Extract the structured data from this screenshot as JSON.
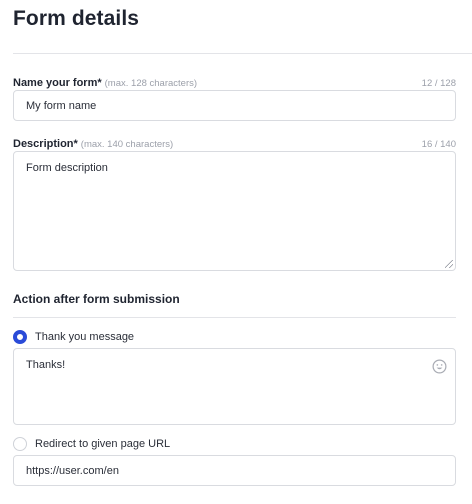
{
  "page": {
    "title": "Form details"
  },
  "form_name": {
    "label": "Name your form*",
    "hint": "(max. 128 characters)",
    "counter": "12 / 128",
    "value": "My form name"
  },
  "description": {
    "label": "Description*",
    "hint": "(max. 140 characters)",
    "counter": "16 / 140",
    "value": "Form description"
  },
  "action": {
    "title": "Action after form submission",
    "thank_you": {
      "label": "Thank you message",
      "checked": true,
      "message": "Thanks!",
      "icon": "smiley-icon"
    },
    "redirect": {
      "label": "Redirect to given page URL",
      "checked": false,
      "url": "https://user.com/en"
    }
  },
  "colors": {
    "accent": "#2a4bd8",
    "border": "#d9dbe0",
    "muted": "#9ca0aa"
  }
}
